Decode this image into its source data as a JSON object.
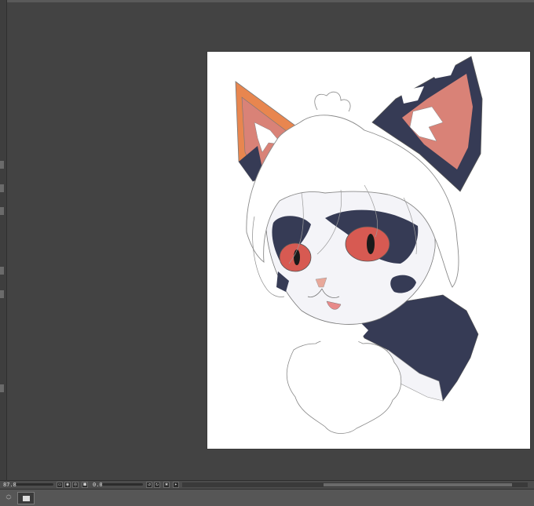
{
  "status": {
    "zoom": "87.8",
    "angle": "0.0"
  },
  "icons": {
    "fit": "fit-icon",
    "actual": "actual-size-icon",
    "rotate_left": "rotate-left-icon",
    "rotate_right": "rotate-right-icon",
    "reset": "reset-rotation-icon",
    "flip": "flip-icon",
    "navigator": "navigator-thumbnail-icon"
  },
  "colors": {
    "workspace": "#434343",
    "paper": "#ffffff",
    "fur_dark": "#363b55",
    "fur_white": "#f4f4f8",
    "ear_inner": "#d98277",
    "ear_orange": "#e8864f",
    "eye_red": "#d75a52"
  }
}
